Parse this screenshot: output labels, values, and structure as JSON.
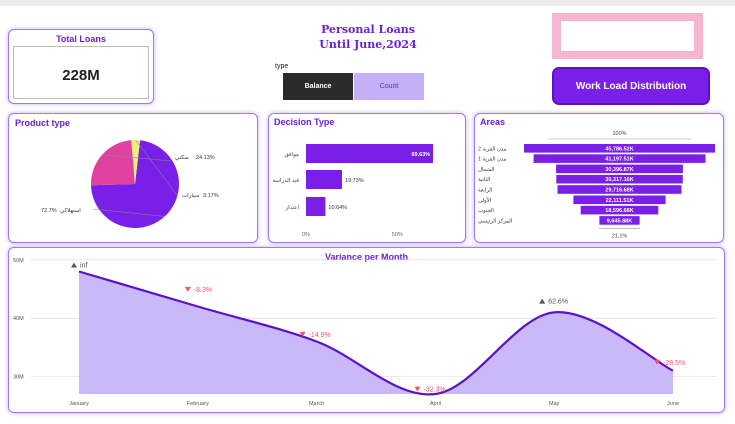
{
  "report": {
    "title_line1": "Personal Loans",
    "title_line2": "Until June,2024"
  },
  "kpi": {
    "title": "Total Loans",
    "value": "228M"
  },
  "slicer": {
    "label": "type",
    "options": [
      "Balance",
      "Count"
    ],
    "selected": "Balance"
  },
  "workload_button": {
    "label": "Work Load Distribution"
  },
  "colors": {
    "accent": "#7a1fe8",
    "light": "#c5b0f7",
    "pink": "#f7b6cf",
    "pie_pink": "#e040a0",
    "pie_yellow": "#f0f07a",
    "negative": "#ff4d6d"
  },
  "product": {
    "title": "Product type",
    "chart_data": {
      "type": "pie",
      "slices": [
        {
          "label": "استهلاكي",
          "value": 72.7,
          "value_text": "72.7%",
          "color": "#7a1fe8"
        },
        {
          "label": "سكني",
          "value": 24.13,
          "value_text": "24.13%",
          "color": "#e040a0"
        },
        {
          "label": "سيارات",
          "value": 3.17,
          "value_text": "3.17%",
          "color": "#f0f07a"
        }
      ]
    }
  },
  "decision": {
    "title": "Decision Type",
    "chart_data": {
      "type": "bar",
      "categories": [
        "موافق",
        "قيد الدراسة",
        "اعتذار"
      ],
      "values": [
        69.63,
        19.73,
        10.64
      ],
      "value_labels": [
        "69.63%",
        "19.73%",
        "10.64%"
      ],
      "xlim": [
        0,
        100
      ],
      "xticks": [
        "0%",
        "50%"
      ]
    }
  },
  "areas": {
    "title": "Areas",
    "chart_data": {
      "type": "bar",
      "subtype": "funnel",
      "top_label": "100%",
      "bottom_label": "21.1%",
      "categories": [
        "مدن القرية 2",
        "مدن القرية 1",
        "الشمال",
        "الثانية",
        "الرابعة",
        "الأولى",
        "الجنوب",
        "المركز الرئيسي"
      ],
      "values": [
        45786.52,
        41197.51,
        30396.87,
        30317.16,
        29716.68,
        22111.51,
        18596.68,
        9645.88
      ],
      "value_labels": [
        "45,786.52K",
        "41,197.51K",
        "30,396.87K",
        "30,317.16K",
        "29,716.68K",
        "22,111.51K",
        "18,596.68K",
        "9,645.88K"
      ]
    }
  },
  "variance": {
    "title": "Variance per Month",
    "chart_data": {
      "type": "area",
      "x": [
        "January",
        "February",
        "March",
        "April",
        "May",
        "June"
      ],
      "y": [
        48,
        42,
        36,
        27,
        41,
        31
      ],
      "y_unit": "M",
      "ylim": [
        27,
        51
      ],
      "yticks": [
        "30M",
        "40M",
        "50M"
      ],
      "annotations": [
        {
          "text": "inf",
          "direction": "up"
        },
        {
          "text": "-8.3%",
          "direction": "down"
        },
        {
          "text": "-14.9%",
          "direction": "down"
        },
        {
          "text": "-32.3%",
          "direction": "down"
        },
        {
          "text": "62.6%",
          "direction": "up"
        },
        {
          "text": "-28.5%",
          "direction": "down"
        }
      ]
    }
  }
}
